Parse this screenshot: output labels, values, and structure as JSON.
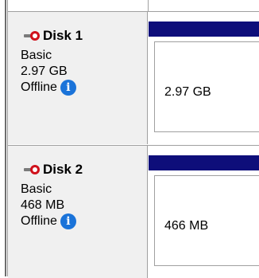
{
  "disks": [
    {
      "title": "Disk 1",
      "type": "Basic",
      "capacity": "2.97 GB",
      "status": "Offline",
      "partition_size": "2.97 GB"
    },
    {
      "title": "Disk 2",
      "type": "Basic",
      "capacity": "468 MB",
      "status": "Offline",
      "partition_size": "466 MB"
    }
  ],
  "colors": {
    "partition_bar": "#0e0e7a",
    "offline_icon": "#d0111b",
    "info_icon": "#1a73d9"
  },
  "icons": {
    "offline": "offline-disk-icon",
    "info": "info-icon"
  }
}
